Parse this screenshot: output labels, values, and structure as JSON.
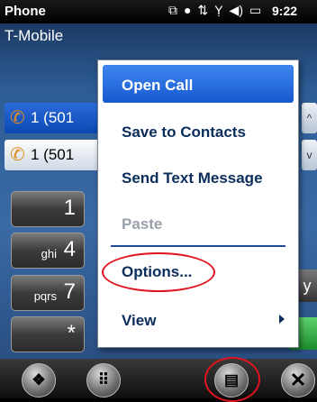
{
  "status_bar": {
    "app_title": "Phone",
    "time": "9:22",
    "icons": [
      "sync-icon",
      "record-icon",
      "data-icon",
      "signal-icon",
      "volume-icon",
      "battery-icon"
    ],
    "icon_glyphs": [
      "⧉",
      "●",
      "⇅",
      "Ỵ",
      "◀)",
      "▭"
    ]
  },
  "carrier": "T-Mobile",
  "calls": [
    {
      "number": "1 (501",
      "selected": true
    },
    {
      "number": "1 (501",
      "selected": false
    }
  ],
  "keypad": [
    {
      "digit": "1",
      "letters": ""
    },
    {
      "digit": "4",
      "letters": "ghi"
    },
    {
      "digit": "7",
      "letters": "pqrs"
    },
    {
      "digit": "*",
      "letters": ""
    }
  ],
  "keypad_partial_letter": "y",
  "context_menu": {
    "items": [
      {
        "label": "Open Call"
      },
      {
        "label": "Save to Contacts"
      },
      {
        "label": "Send Text Message"
      },
      {
        "label": "Paste",
        "disabled": true
      },
      {
        "label": "Options..."
      },
      {
        "label": "View",
        "has_submenu": true
      }
    ]
  },
  "bottom_bar": {
    "start_glyph": "❖",
    "keyboard_glyph": "⠿",
    "menu_glyph": "▤",
    "close_glyph": "✕"
  },
  "colors": {
    "menu_highlight": "#1759cf",
    "annotation_red": "#e0141e",
    "menu_text": "#0a2d5c",
    "background_blue": "#2e5d96"
  }
}
